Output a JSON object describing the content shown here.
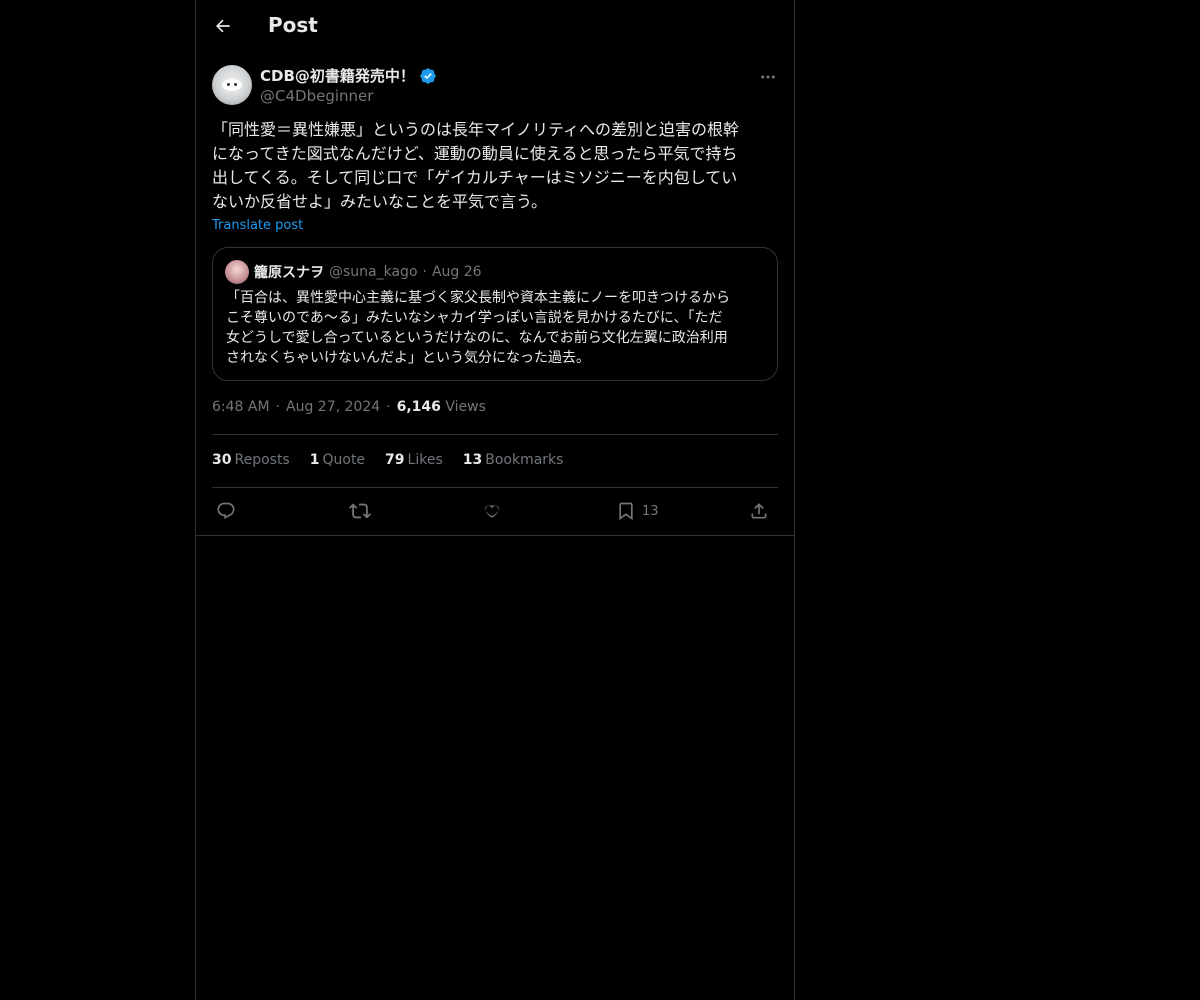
{
  "header": {
    "title": "Post"
  },
  "author": {
    "name": "CDB@初書籍発売中！",
    "handle": "@C4Dbeginner"
  },
  "post": {
    "text": "「同性愛＝異性嫌悪」というのは長年マイノリティへの差別と迫害の根幹\nになってきた図式なんだけど、運動の動員に使えると思ったら平気で持ち\n出してくる。そして同じ口で「ゲイカルチャーはミソジニーを内包してい\nないか反省せよ」みたいなことを平気で言う。",
    "translate_label": "Translate post"
  },
  "quote": {
    "name": "籠原スナヲ",
    "handle": "@suna_kago",
    "dot": "·",
    "date": "Aug 26",
    "text": "「百合は、異性愛中心主義に基づく家父長制や資本主義にノーを叩きつけるから\nこそ尊いのであ〜る」みたいなシャカイ学っぽい言説を見かけるたびに、「ただ\n女どうしで愛し合っているというだけなのに、なんでお前ら文化左翼に政治利用\nされなくちゃいけないんだよ」という気分になった過去。"
  },
  "meta": {
    "time": "6:48 AM",
    "dot1": "·",
    "date": "Aug 27, 2024",
    "dot2": "·",
    "views_count": "6,146",
    "views_label": "Views"
  },
  "stats": {
    "reposts_count": "30",
    "reposts_label": "Reposts",
    "quote_count": "1",
    "quote_label": "Quote",
    "likes_count": "79",
    "likes_label": "Likes",
    "bookmarks_count": "13",
    "bookmarks_label": "Bookmarks"
  },
  "actions": {
    "bookmark_count": "13"
  },
  "colors": {
    "background": "#000000",
    "text": "#e7e9ea",
    "muted": "#71767b",
    "accent": "#1d9bf0",
    "border": "#2f3336"
  }
}
